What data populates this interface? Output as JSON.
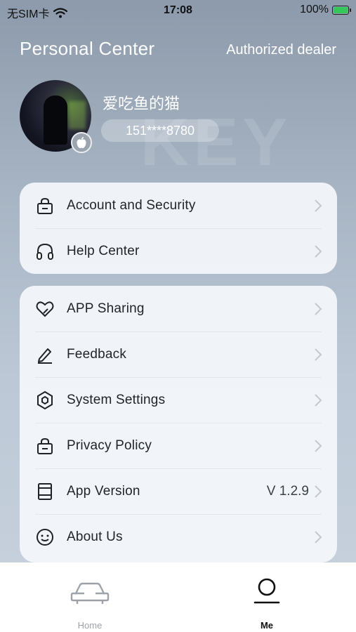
{
  "status_bar": {
    "carrier": "无SIM卡",
    "time": "17:08",
    "battery": "100%"
  },
  "header": {
    "title": "Personal Center",
    "dealer_link": "Authorized dealer",
    "watermark": "KEY"
  },
  "profile": {
    "username": "爱吃鱼的猫",
    "phone": "151****8780"
  },
  "menu_group_1": [
    {
      "label": "Account and Security",
      "icon": "lock-icon"
    },
    {
      "label": "Help Center",
      "icon": "headphones-icon"
    }
  ],
  "menu_group_2": [
    {
      "label": "APP Sharing",
      "icon": "heart-icon"
    },
    {
      "label": "Feedback",
      "icon": "pencil-icon"
    },
    {
      "label": "System Settings",
      "icon": "hexagon-icon"
    },
    {
      "label": "Privacy Policy",
      "icon": "lock-icon"
    },
    {
      "label": "App Version",
      "icon": "document-icon",
      "value": "V 1.2.9"
    },
    {
      "label": "About Us",
      "icon": "smiley-icon"
    }
  ],
  "tab_bar": {
    "home_label": "Home",
    "me_label": "Me",
    "active": "Me"
  },
  "colors": {
    "battery_green": "#35c759",
    "active_tab": "#111111",
    "inactive_tab": "#9ea3a9"
  }
}
